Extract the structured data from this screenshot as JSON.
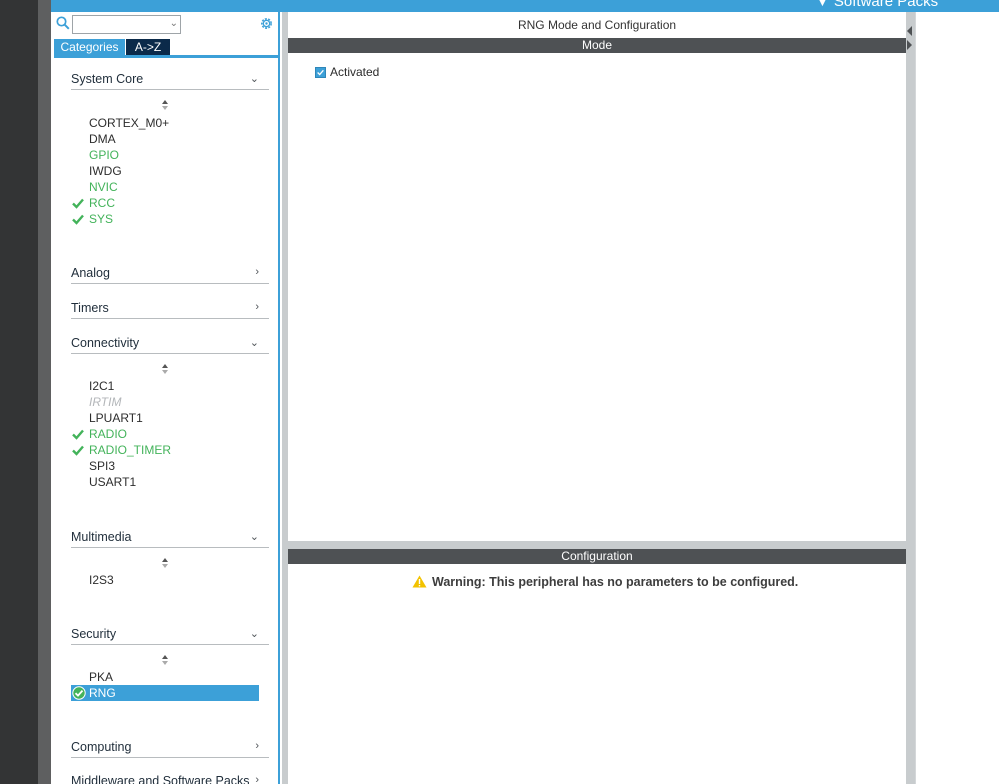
{
  "header": {
    "software_packs_label": "Software Packs"
  },
  "left_panel": {
    "search": {
      "value": ""
    },
    "tabs": {
      "categories": "Categories",
      "az": "A->Z"
    },
    "categories": {
      "system_core": {
        "label": "System Core",
        "items": [
          "CORTEX_M0+",
          "DMA",
          "GPIO",
          "IWDG",
          "NVIC",
          "RCC",
          "SYS"
        ]
      },
      "analog": {
        "label": "Analog"
      },
      "timers": {
        "label": "Timers"
      },
      "connectivity": {
        "label": "Connectivity",
        "items": [
          "I2C1",
          "IRTIM",
          "LPUART1",
          "RADIO",
          "RADIO_TIMER",
          "SPI3",
          "USART1"
        ]
      },
      "multimedia": {
        "label": "Multimedia",
        "items": [
          "I2S3"
        ]
      },
      "security": {
        "label": "Security",
        "items": [
          "PKA",
          "RNG"
        ]
      },
      "computing": {
        "label": "Computing"
      },
      "middleware": {
        "label": "Middleware and Software Packs"
      }
    }
  },
  "main": {
    "title": "RNG Mode and Configuration",
    "mode_header": "Mode",
    "activated_label": "Activated",
    "activated_checked": true,
    "config_header": "Configuration",
    "warning": "Warning: This peripheral has no parameters to be configured."
  },
  "colors": {
    "accent": "#3ca0d8",
    "green": "#43b35a",
    "header_dark": "#4e5154",
    "warning": "#f2c200"
  }
}
